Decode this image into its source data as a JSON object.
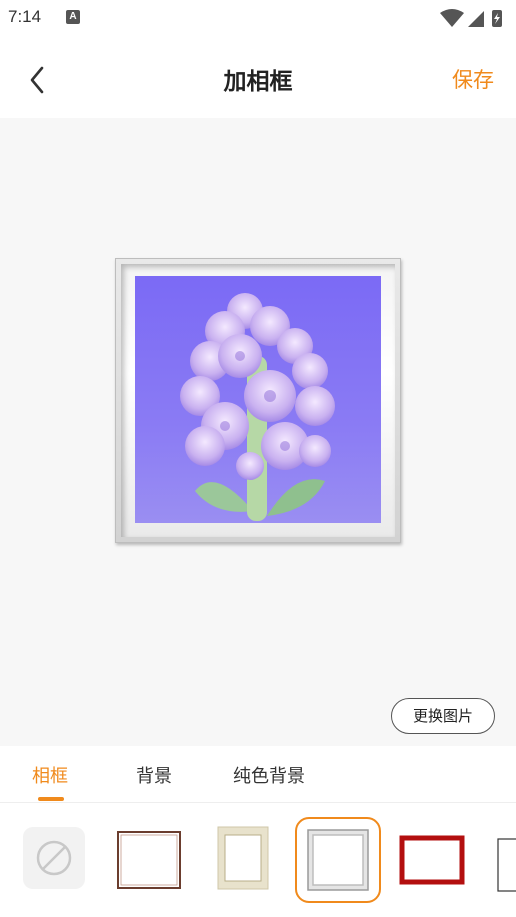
{
  "status_bar": {
    "time": "7:14",
    "notification_badge": "A"
  },
  "header": {
    "title": "加相框",
    "save_label": "保存",
    "back_icon": "chevron-left-icon"
  },
  "preview": {
    "change_photo_label": "更换图片"
  },
  "tabs": [
    {
      "label": "相框",
      "active": true
    },
    {
      "label": "背景",
      "active": false
    },
    {
      "label": "纯色背景",
      "active": false
    }
  ],
  "frames": {
    "selected_index": 3,
    "options": [
      {
        "icon": "no-frame-icon"
      },
      {
        "icon": "thin-brown-frame-icon"
      },
      {
        "icon": "beige-wood-frame-icon"
      },
      {
        "icon": "silver-frame-icon"
      },
      {
        "icon": "red-frame-icon"
      },
      {
        "icon": "black-frame-icon"
      }
    ]
  },
  "colors": {
    "accent": "#f08a1c",
    "photo_background": "#7b6af5"
  }
}
